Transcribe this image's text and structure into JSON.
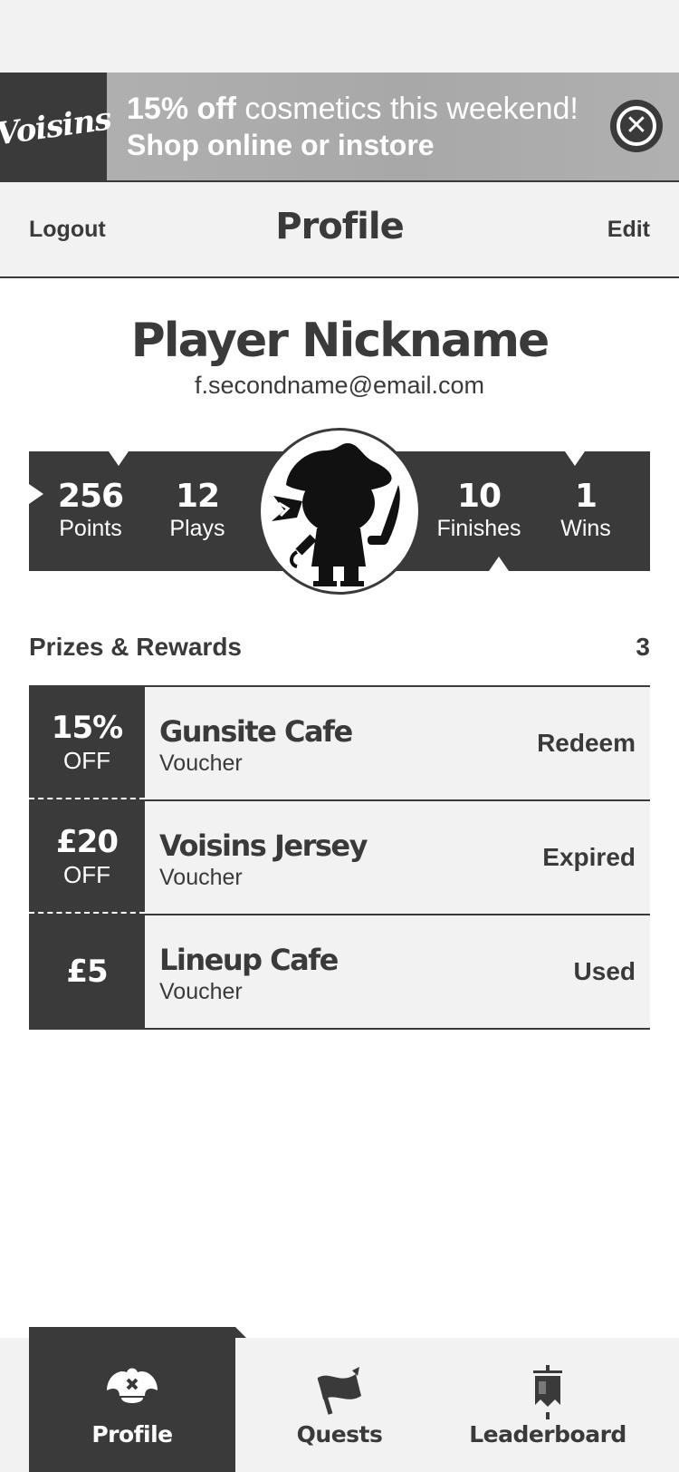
{
  "banner": {
    "logo_text": "Voisins",
    "highlight": "15% off",
    "line1_rest": " cosmetics this weekend!",
    "line2": "Shop online or instore",
    "close_icon": "close-icon"
  },
  "navbar": {
    "left_label": "Logout",
    "title": "Profile",
    "right_label": "Edit"
  },
  "profile": {
    "nickname": "Player Nickname",
    "email": "f.secondname@email.com",
    "avatar_icon": "pirate-avatar-icon"
  },
  "stats": [
    {
      "value": "256",
      "label": "Points"
    },
    {
      "value": "12",
      "label": "Plays"
    },
    {
      "value": "10",
      "label": "Finishes"
    },
    {
      "value": "1",
      "label": "Wins"
    }
  ],
  "prizes": {
    "title": "Prizes & Rewards",
    "count": "3",
    "items": [
      {
        "amount": "15%",
        "off": "OFF",
        "name": "Gunsite Cafe",
        "type": "Voucher",
        "status": "Redeem"
      },
      {
        "amount": "£20",
        "off": "OFF",
        "name": "Voisins Jersey",
        "type": "Voucher",
        "status": "Expired"
      },
      {
        "amount": "£5",
        "off": "",
        "name": "Lineup Cafe",
        "type": "Voucher",
        "status": "Used"
      }
    ]
  },
  "tabs": [
    {
      "label": "Profile",
      "icon": "pirate-hat-icon",
      "active": true
    },
    {
      "label": "Quests",
      "icon": "flag-icon",
      "active": false
    },
    {
      "label": "Leaderboard",
      "icon": "banner-icon",
      "active": false
    }
  ],
  "colors": {
    "dark": "#3a3a3a",
    "light": "#f2f2f2",
    "banner": "#b0b0b0",
    "white": "#ffffff"
  }
}
